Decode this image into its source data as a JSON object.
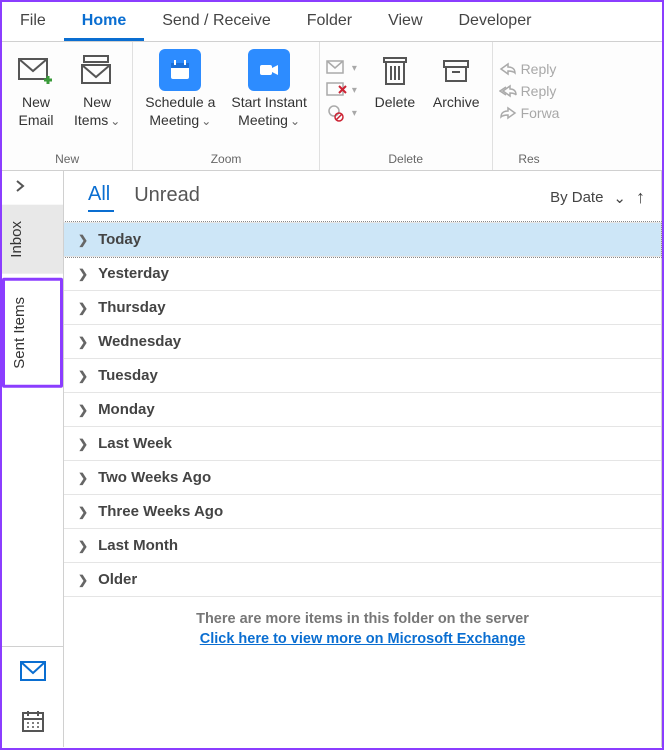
{
  "menubar": {
    "items": [
      "File",
      "Home",
      "Send / Receive",
      "Folder",
      "View",
      "Developer"
    ],
    "active": "Home"
  },
  "ribbon": {
    "groups": [
      {
        "label": "New",
        "buttons": [
          {
            "id": "new-email",
            "line1": "New",
            "line2": "Email",
            "dropdown": false
          },
          {
            "id": "new-items",
            "line1": "New",
            "line2": "Items",
            "dropdown": true
          }
        ]
      },
      {
        "label": "Zoom",
        "buttons": [
          {
            "id": "schedule-meeting",
            "line1": "Schedule a",
            "line2": "Meeting",
            "dropdown": true
          },
          {
            "id": "start-instant-meeting",
            "line1": "Start Instant",
            "line2": "Meeting",
            "dropdown": true
          }
        ]
      },
      {
        "label": "Delete",
        "mini": [
          {
            "id": "ignore",
            "label": ""
          },
          {
            "id": "junk",
            "label": ""
          },
          {
            "id": "cleanup",
            "label": ""
          }
        ],
        "buttons": [
          {
            "id": "delete",
            "line1": "Delete",
            "line2": "",
            "dropdown": false
          },
          {
            "id": "archive",
            "line1": "Archive",
            "line2": "",
            "dropdown": false
          }
        ]
      },
      {
        "label": "Res",
        "respond": [
          {
            "id": "reply",
            "label": "Reply"
          },
          {
            "id": "reply-all",
            "label": "Reply"
          },
          {
            "id": "forward",
            "label": "Forwa"
          }
        ]
      }
    ]
  },
  "sidebar": {
    "folders": [
      {
        "id": "inbox",
        "label": "Inbox",
        "selected": true
      },
      {
        "id": "sent-items",
        "label": "Sent Items",
        "highlighted": true
      }
    ]
  },
  "list": {
    "filters": {
      "all": "All",
      "unread": "Unread",
      "active": "All"
    },
    "sort": {
      "label": "By Date",
      "direction": "asc"
    },
    "groups": [
      {
        "label": "Today",
        "selected": true
      },
      {
        "label": "Yesterday"
      },
      {
        "label": "Thursday"
      },
      {
        "label": "Wednesday"
      },
      {
        "label": "Tuesday"
      },
      {
        "label": "Monday"
      },
      {
        "label": "Last Week"
      },
      {
        "label": "Two Weeks Ago"
      },
      {
        "label": "Three Weeks Ago"
      },
      {
        "label": "Last Month"
      },
      {
        "label": "Older"
      }
    ],
    "footer": {
      "msg": "There are more items in this folder on the server",
      "link": "Click here to view more on Microsoft Exchange"
    }
  }
}
